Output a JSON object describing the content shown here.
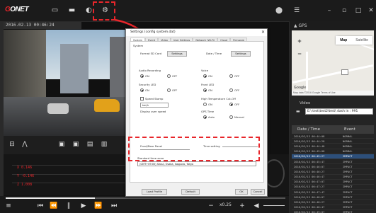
{
  "app": {
    "logo_text": "ONET",
    "accent": "#e8262b"
  },
  "toolbar": {
    "icons": [
      "monitor-icon",
      "folder-icon",
      "record-icon",
      "settings-gear-icon"
    ],
    "window_icons": [
      "location-pin-icon",
      "list-icon",
      "minimize-icon",
      "restore-icon",
      "maximize-icon",
      "close-icon"
    ]
  },
  "video": {
    "header": "2016.02.13  00:46:24"
  },
  "graph_values": {
    "x": "0.146",
    "y": "-0.146",
    "z": "1.008"
  },
  "playback": {
    "speed": "x0.25"
  },
  "gps": {
    "header": "GPS"
  },
  "map": {
    "tab_map": "Map",
    "tab_satellite": "Satellite",
    "zoom_in": "+",
    "zoom_out": "−",
    "google": "Google",
    "footer": "Map data ©2016 Google  Terms of Use"
  },
  "video_data": {
    "header": "Video",
    "path": "E:\\ test\\test2\\test\\ dash in : 991",
    "col_date": "Date / Time",
    "col_event": "Event",
    "rows": [
      {
        "date": "2016/02/13 00:44:08",
        "event": "NORMAL"
      },
      {
        "date": "2016/02/13 00:44:28",
        "event": "NORMAL"
      },
      {
        "date": "2016/02/13 00:44:48",
        "event": "NORMAL"
      },
      {
        "date": "2016/02/13 00:45:08",
        "event": "NORMAL"
      },
      {
        "date": "2016/02/13 00:45:27",
        "event": "IMPACT"
      },
      {
        "date": "2016/02/13 00:45:47",
        "event": "IMPACT"
      },
      {
        "date": "2016/02/13 00:46:07",
        "event": "IMPACT"
      },
      {
        "date": "2016/02/13 00:46:27",
        "event": "IMPACT"
      },
      {
        "date": "2016/02/13 00:46:47",
        "event": "IMPACT"
      },
      {
        "date": "2016/02/13 00:47:07",
        "event": "IMPACT"
      },
      {
        "date": "2016/02/13 00:47:27",
        "event": "IMPACT"
      },
      {
        "date": "2016/02/13 00:47:47",
        "event": "IMPACT"
      },
      {
        "date": "2016/02/13 00:48:07",
        "event": "IMPACT"
      },
      {
        "date": "2016/02/13 00:48:27",
        "event": "IMPACT"
      },
      {
        "date": "2016/02/13 00:48:47",
        "event": "IMPACT"
      },
      {
        "date": "2016/02/13 00:49:07",
        "event": "IMPACT"
      }
    ]
  },
  "dialog": {
    "title": "Settings (config system.dat)",
    "tabs": [
      "System",
      "Event",
      "Video",
      "User Settings",
      "Network (Wi-Fi)",
      "Cloud",
      "Firmware"
    ],
    "selected_tab": "System",
    "section_system": "System",
    "format_label": "Format SD Card",
    "format_btn": "Settings",
    "date_time_label": "Date / Time",
    "date_time_btn": "Settings",
    "audio_rec_label": "Audio Recording",
    "voice_label": "Voice",
    "on": "ON",
    "off": "OFF",
    "security_led_label": "Security LED",
    "front_led_label": "Front LED",
    "speed_stamp_label": "Speed Stamp",
    "high_temp_label": "High Temperature Cut-Off",
    "speed_unit_select": "km/h",
    "gps_label": "GPS Time",
    "display_label": "Display over speed",
    "auto": "Auto",
    "manual": "Manual",
    "front_panel_label": "Front/Rear Panel",
    "time_setting_label": "Time setting",
    "timezone_label": "Standard time zone",
    "timezone_value": "(GMT+09:00) Seoul, Osaka, Sapporo, Tokyo",
    "btn_load": "Load Profile",
    "btn_default": "Default",
    "btn_ok": "OK",
    "btn_cancel": "Cancel"
  }
}
